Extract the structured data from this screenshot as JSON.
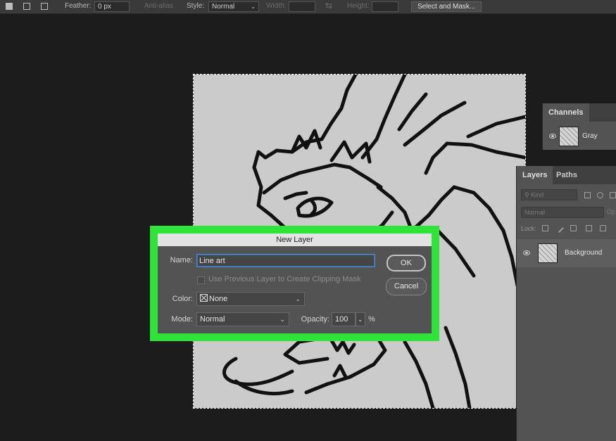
{
  "options_bar": {
    "feather_label": "Feather:",
    "feather_value": "0 px",
    "anti_alias_label": "Anti-alias",
    "style_label": "Style:",
    "style_value": "Normal",
    "width_label": "Width:",
    "height_label": "Height:",
    "select_mask_label": "Select and Mask..."
  },
  "channels_panel": {
    "tab": "Channels",
    "channel_name": "Gray"
  },
  "layers_panel": {
    "tab_layers": "Layers",
    "tab_paths": "Paths",
    "kind_placeholder": "Kind",
    "blend_mode": "Normal",
    "opacity_fragment": "Op",
    "lock_label": "Lock:",
    "layer_name": "Background"
  },
  "dialog": {
    "title": "New Layer",
    "name_label": "Name:",
    "name_value": "Line art",
    "clipping_label": "Use Previous Layer to Create Clipping Mask",
    "color_label": "Color:",
    "color_value": "None",
    "mode_label": "Mode:",
    "mode_value": "Normal",
    "opacity_label": "Opacity:",
    "opacity_value": "100",
    "opacity_unit": "%",
    "ok_label": "OK",
    "cancel_label": "Cancel"
  },
  "colors": {
    "highlight": "#2fe339",
    "app_bg": "#1c1c1c",
    "panel_bg": "#535353",
    "canvas_bg": "#cbcbcb"
  }
}
